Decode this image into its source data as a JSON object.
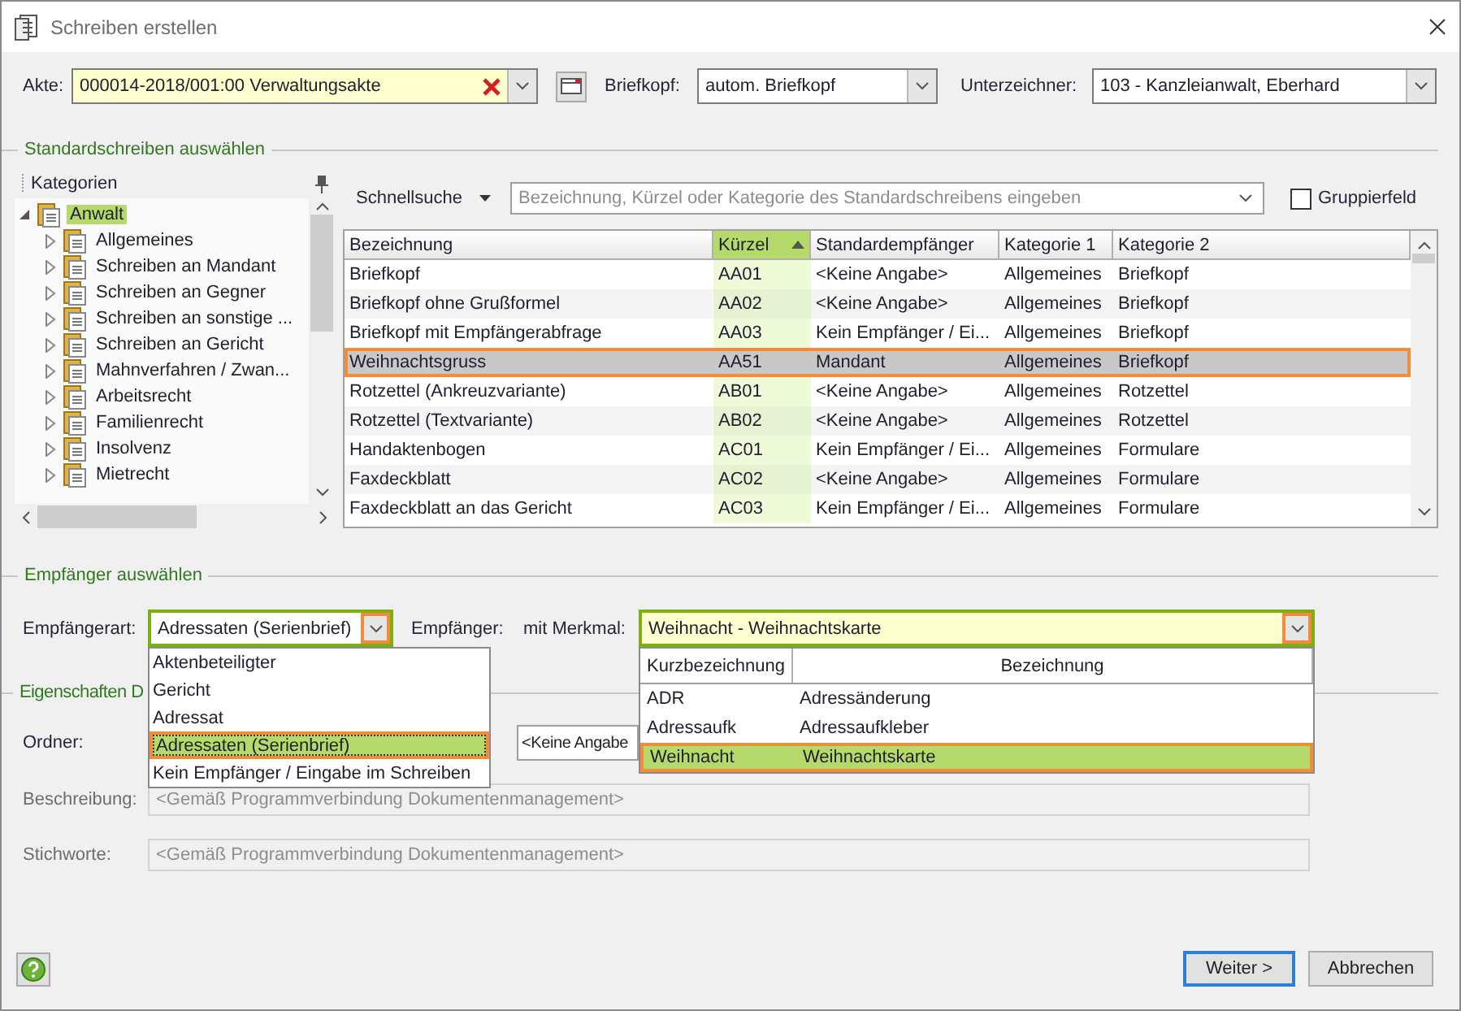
{
  "window": {
    "title": "Schreiben erstellen"
  },
  "top_bar": {
    "akte": {
      "label": "Akte:",
      "value": "000014-2018/001:00  Verwaltungsakte"
    },
    "briefkopf": {
      "label": "Briefkopf:",
      "value": "autom. Briefkopf"
    },
    "unterzeichner": {
      "label": "Unterzeichner:",
      "value": "103 - Kanzleianwalt, Eberhard"
    }
  },
  "standard_section": {
    "title": "Standardschreiben auswählen",
    "categories": {
      "title": "Kategorien",
      "tree": [
        {
          "label": "Anwalt",
          "selected": true,
          "expanded": true,
          "children": [
            {
              "label": "Allgemeines",
              "selected": false,
              "expanded": false
            },
            {
              "label": "Schreiben an Mandant",
              "selected": false,
              "expanded": false
            },
            {
              "label": "Schreiben an Gegner",
              "selected": false,
              "expanded": false
            },
            {
              "label": "Schreiben an sonstige ...",
              "selected": false,
              "expanded": false
            },
            {
              "label": "Schreiben an Gericht",
              "selected": false,
              "expanded": false
            },
            {
              "label": "Mahnverfahren / Zwan...",
              "selected": false,
              "expanded": false
            },
            {
              "label": "Arbeitsrecht",
              "selected": false,
              "expanded": false
            },
            {
              "label": "Familienrecht",
              "selected": false,
              "expanded": false
            },
            {
              "label": "Insolvenz",
              "selected": false,
              "expanded": false
            },
            {
              "label": "Mietrecht",
              "selected": false,
              "expanded": false
            }
          ]
        }
      ]
    },
    "quick_search": {
      "label": "Schnellsuche",
      "placeholder": "Bezeichnung, Kürzel oder Kategorie des Standardschreibens eingeben"
    },
    "group_checkbox": {
      "label": "Gruppierfeld",
      "checked": false
    },
    "table": {
      "columns": [
        {
          "label": "Bezeichnung",
          "sorted": false
        },
        {
          "label": "Kürzel",
          "sorted": true
        },
        {
          "label": "Standardempfänger",
          "sorted": false
        },
        {
          "label": "Kategorie 1",
          "sorted": false
        },
        {
          "label": "Kategorie 2",
          "sorted": false
        }
      ],
      "rows": [
        {
          "cells": [
            "Briefkopf",
            "AA01",
            "<Keine Angabe>",
            "Allgemeines",
            "Briefkopf"
          ],
          "selected": false
        },
        {
          "cells": [
            "Briefkopf ohne Grußformel",
            "AA02",
            "<Keine Angabe>",
            "Allgemeines",
            "Briefkopf"
          ],
          "selected": false
        },
        {
          "cells": [
            "Briefkopf mit Empfängerabfrage",
            "AA03",
            "Kein Empfänger / Ei...",
            "Allgemeines",
            "Briefkopf"
          ],
          "selected": false
        },
        {
          "cells": [
            "Weihnachtsgruss",
            "AA51",
            "Mandant",
            "Allgemeines",
            "Briefkopf"
          ],
          "selected": true
        },
        {
          "cells": [
            "Rotzettel (Ankreuzvariante)",
            "AB01",
            "<Keine Angabe>",
            "Allgemeines",
            "Rotzettel"
          ],
          "selected": false
        },
        {
          "cells": [
            "Rotzettel (Textvariante)",
            "AB02",
            "<Keine Angabe>",
            "Allgemeines",
            "Rotzettel"
          ],
          "selected": false
        },
        {
          "cells": [
            "Handaktenbogen",
            "AC01",
            "Kein Empfänger / Ei...",
            "Allgemeines",
            "Formulare"
          ],
          "selected": false
        },
        {
          "cells": [
            "Faxdeckblatt",
            "AC02",
            "<Keine Angabe>",
            "Allgemeines",
            "Formulare"
          ],
          "selected": false
        },
        {
          "cells": [
            "Faxdeckblatt an das Gericht",
            "AC03",
            "Kein Empfänger / Ei...",
            "Allgemeines",
            "Formulare"
          ],
          "selected": false
        }
      ]
    }
  },
  "recipient_section": {
    "title": "Empfänger auswählen",
    "type_label": "Empfängerart:",
    "type_value": "Adressaten (Serienbrief)",
    "type_options": [
      {
        "label": "Aktenbeteiligter",
        "selected": false
      },
      {
        "label": "Gericht",
        "selected": false
      },
      {
        "label": "Adressat",
        "selected": false
      },
      {
        "label": "Adressaten (Serienbrief)",
        "selected": true
      },
      {
        "label": "Kein Empfänger / Eingabe im Schreiben",
        "selected": false
      }
    ],
    "recipient_label": "Empfänger:",
    "feature_label": "mit Merkmal:",
    "feature_value": "Weihnacht - Weihnachtskarte",
    "feature_columns": [
      "Kurzbezeichnung",
      "Bezeichnung"
    ],
    "feature_rows": [
      {
        "cells": [
          "ADR",
          "Adressänderung"
        ],
        "selected": false
      },
      {
        "cells": [
          "Adressaufk",
          "Adressaufkleber"
        ],
        "selected": false
      },
      {
        "cells": [
          "Weihnacht",
          "Weihnachtskarte"
        ],
        "selected": true
      }
    ]
  },
  "properties_section": {
    "title": "Eigenschaften D",
    "fields": [
      {
        "label": "Ordner:",
        "value": "<Keine Angabe",
        "disabled": false
      },
      {
        "label": "Beschreibung:",
        "value": "<Gemäß Programmverbindung Dokumentenmanagement>",
        "disabled": true
      },
      {
        "label": "Stichworte:",
        "value": "<Gemäß Programmverbindung Dokumentenmanagement>",
        "disabled": true
      }
    ]
  },
  "buttons": [
    {
      "label": "Weiter >",
      "default": true
    },
    {
      "label": "Abbrechen",
      "default": false
    }
  ]
}
